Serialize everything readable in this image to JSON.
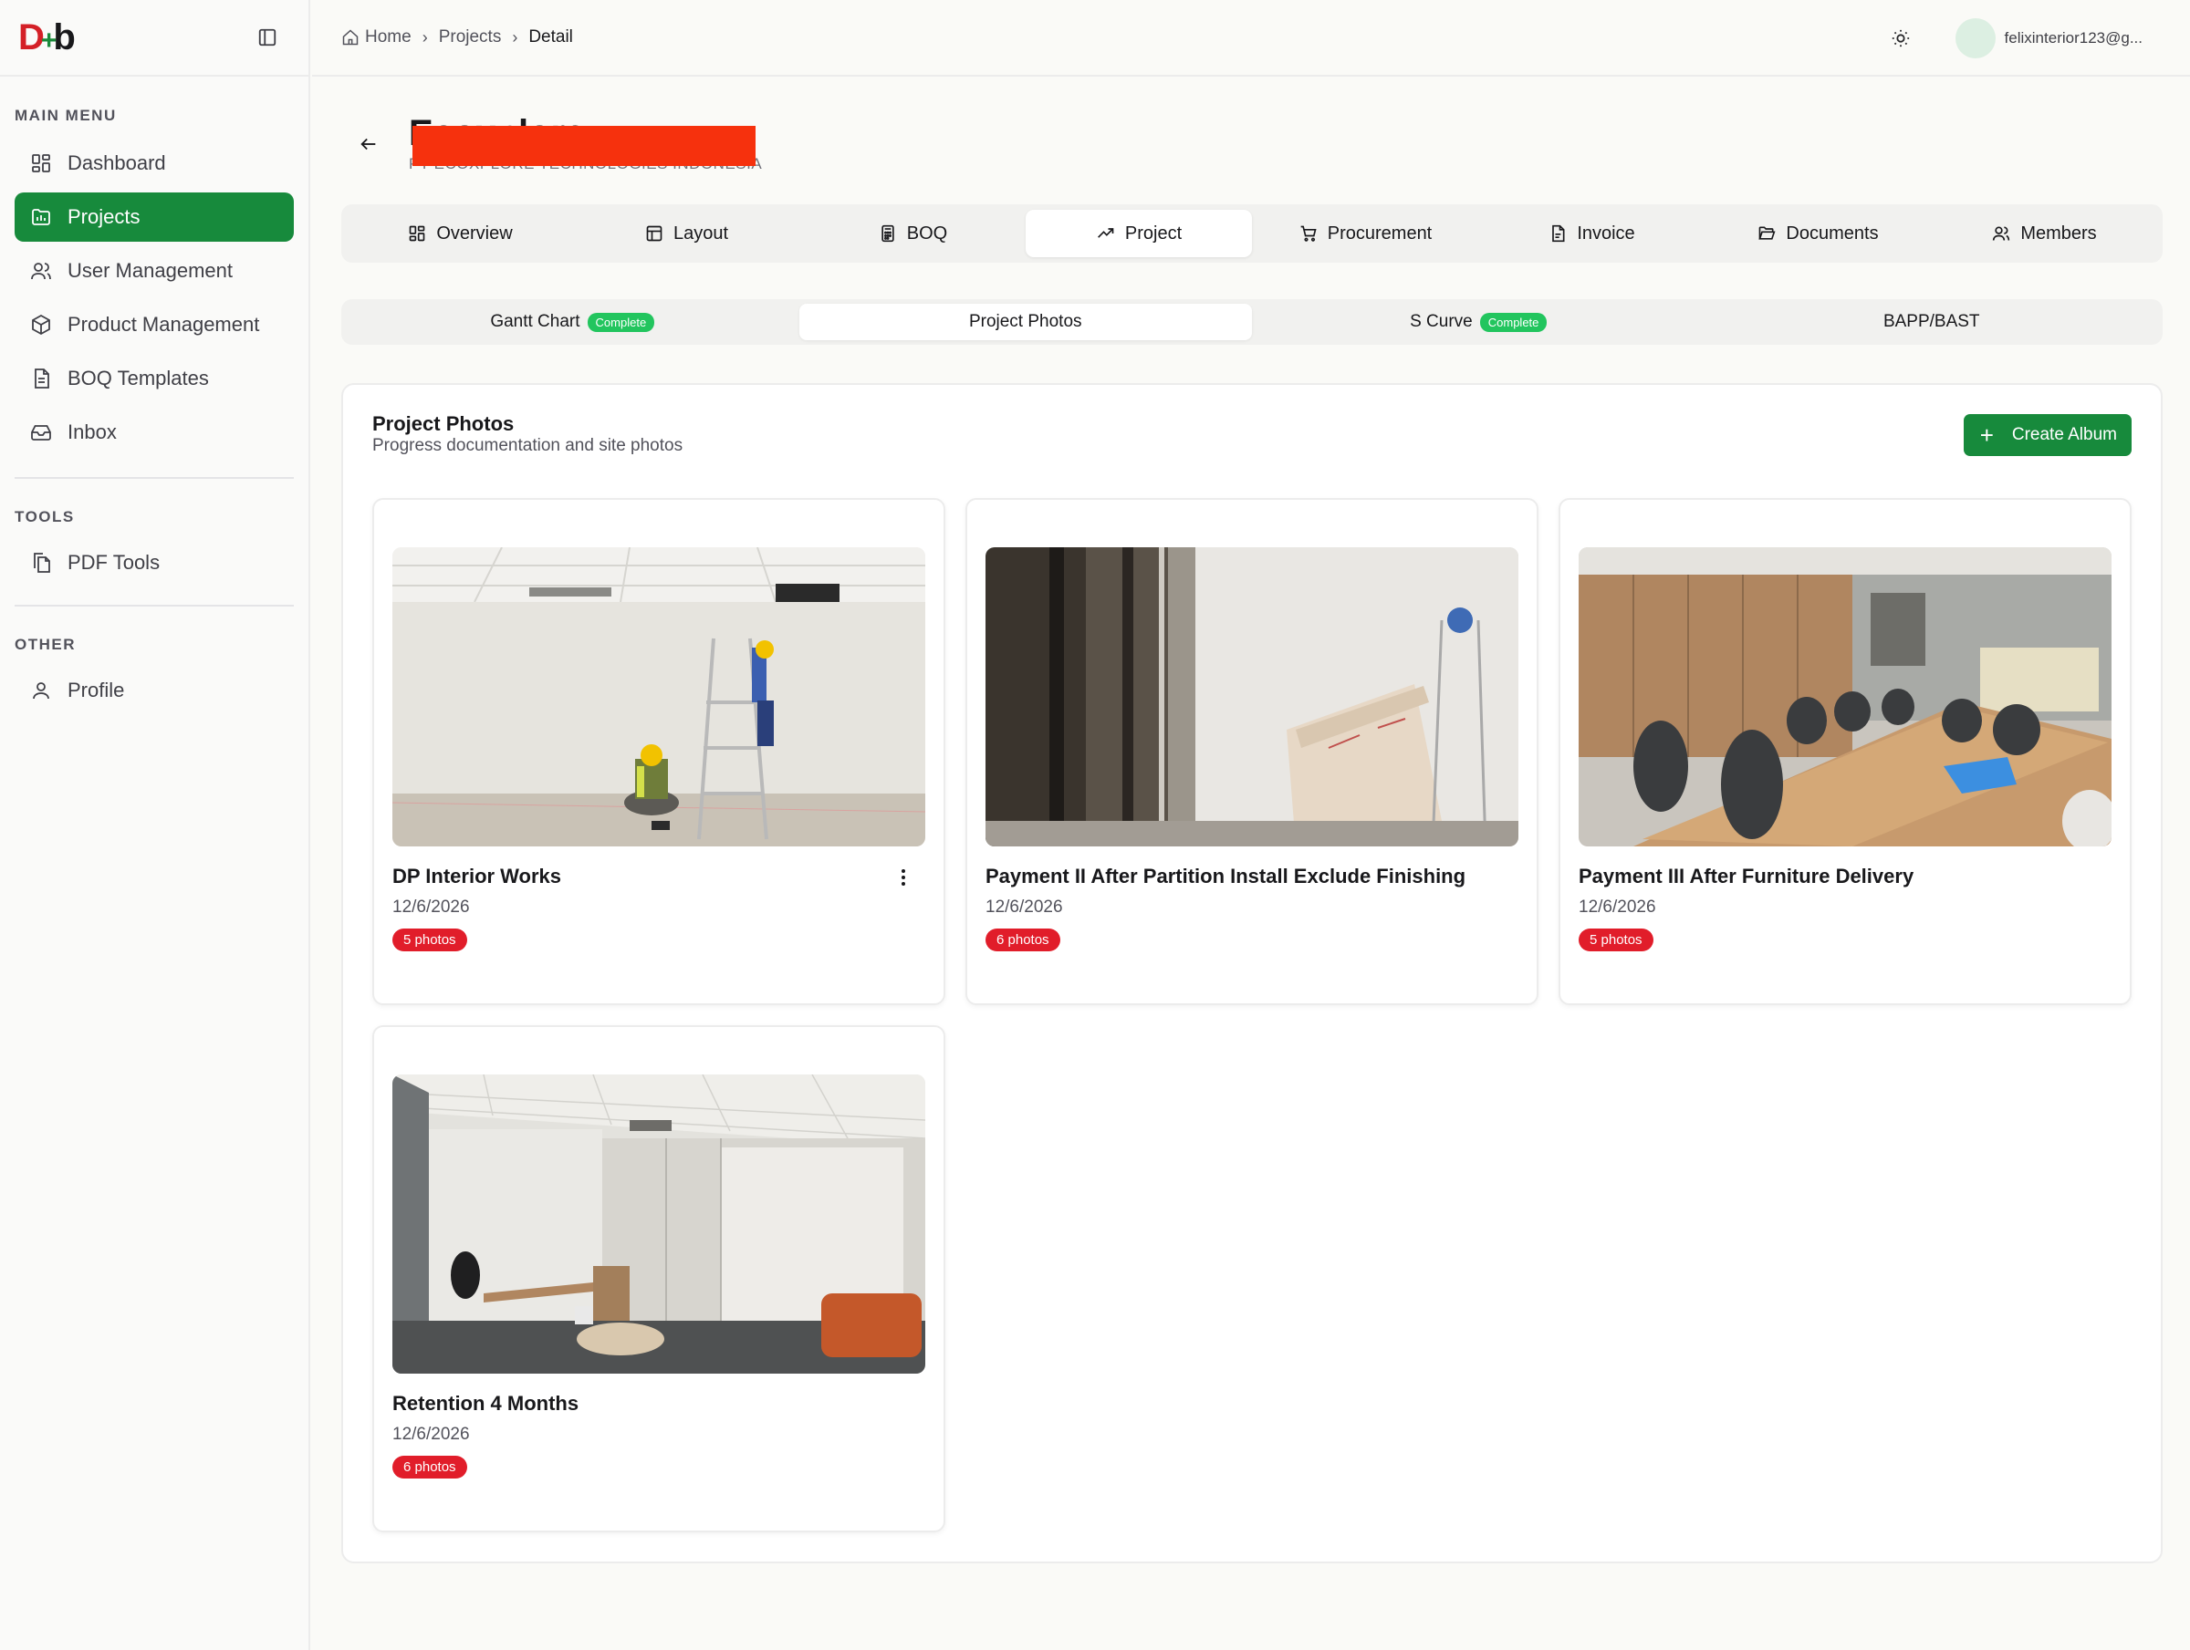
{
  "brand": {
    "logo_d": "D",
    "logo_plus": "+",
    "logo_b": "b"
  },
  "sidebar": {
    "sections": [
      {
        "label": "MAIN MENU",
        "items": [
          {
            "label": "Dashboard",
            "icon": "dashboard-icon"
          },
          {
            "label": "Projects",
            "icon": "folder-chart-icon",
            "active": true
          },
          {
            "label": "User Management",
            "icon": "users-icon"
          },
          {
            "label": "Product Management",
            "icon": "package-icon"
          },
          {
            "label": "BOQ Templates",
            "icon": "file-text-icon"
          },
          {
            "label": "Inbox",
            "icon": "inbox-icon"
          }
        ]
      },
      {
        "label": "TOOLS",
        "items": [
          {
            "label": "PDF Tools",
            "icon": "files-icon"
          }
        ]
      },
      {
        "label": "OTHER",
        "items": [
          {
            "label": "Profile",
            "icon": "user-icon"
          }
        ]
      }
    ]
  },
  "topbar": {
    "breadcrumb": [
      "Home",
      "Projects",
      "Detail"
    ],
    "user_email": "felixinterior123@g..."
  },
  "project": {
    "title": "Ecoxplore",
    "subtitle": "PT ECOXPLORE TECHNOLOGIES INDONESIA"
  },
  "tabs": [
    {
      "label": "Overview",
      "icon": "grid-icon"
    },
    {
      "label": "Layout",
      "icon": "layout-icon"
    },
    {
      "label": "BOQ",
      "icon": "calculator-icon"
    },
    {
      "label": "Project",
      "icon": "trending-up-icon",
      "active": true
    },
    {
      "label": "Procurement",
      "icon": "cart-icon"
    },
    {
      "label": "Invoice",
      "icon": "file-icon"
    },
    {
      "label": "Documents",
      "icon": "folder-open-icon"
    },
    {
      "label": "Members",
      "icon": "members-icon"
    }
  ],
  "subtabs": [
    {
      "label": "Gantt Chart",
      "badge": "Complete"
    },
    {
      "label": "Project Photos",
      "active": true
    },
    {
      "label": "S Curve",
      "badge": "Complete"
    },
    {
      "label": "BAPP/BAST"
    }
  ],
  "photos_panel": {
    "title": "Project Photos",
    "subtitle": "Progress documentation and site photos",
    "create_label": "Create Album"
  },
  "albums": [
    {
      "title": "DP Interior Works",
      "date": "12/6/2026",
      "count": "5 photos",
      "has_menu": true
    },
    {
      "title": "Payment II After Partition Install Exclude Finishing",
      "date": "12/6/2026",
      "count": "6 photos"
    },
    {
      "title": "Payment III After Furniture Delivery",
      "date": "12/6/2026",
      "count": "5 photos"
    },
    {
      "title": "Retention 4 Months",
      "date": "12/6/2026",
      "count": "6 photos"
    }
  ],
  "colors": {
    "accent": "#178a3c",
    "badge_red": "#e11d2a",
    "badge_green": "#22c55e",
    "redaction": "#f6310d"
  }
}
